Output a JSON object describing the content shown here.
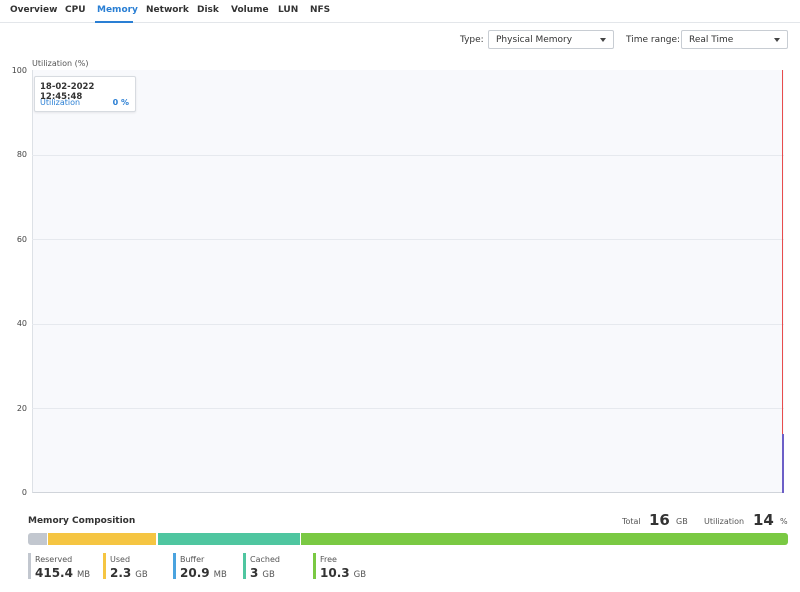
{
  "tabs": [
    {
      "label": "Overview",
      "active": false
    },
    {
      "label": "CPU",
      "active": false
    },
    {
      "label": "Memory",
      "active": true
    },
    {
      "label": "Network",
      "active": false
    },
    {
      "label": "Disk",
      "active": false
    },
    {
      "label": "Volume",
      "active": false
    },
    {
      "label": "LUN",
      "active": false
    },
    {
      "label": "NFS",
      "active": false
    }
  ],
  "filters": {
    "type_label": "Type:",
    "type_value": "Physical Memory",
    "time_label": "Time range:",
    "time_value": "Real Time"
  },
  "chart_data": {
    "type": "line",
    "title": "",
    "ylabel": "Utilization (%)",
    "ylim": [
      0,
      100
    ],
    "yticks": [
      "100",
      "80",
      "60",
      "40",
      "20",
      "0"
    ],
    "grid": true,
    "series": [
      {
        "name": "Utilization",
        "values": [
          0,
          14
        ]
      }
    ],
    "tooltip": {
      "date": "18-02-2022 12:45:48",
      "label": "Utilization",
      "value": "0 %"
    }
  },
  "composition": {
    "title": "Memory Composition",
    "total_label": "Total",
    "total_value": "16",
    "total_unit": "GB",
    "util_label": "Utilization",
    "util_value": "14",
    "util_unit": "%",
    "segments": [
      {
        "name": "Reserved",
        "value": "415.4",
        "unit": "MB",
        "color": "#c2c7cf",
        "fraction": 0.025
      },
      {
        "name": "Used",
        "value": "2.3",
        "unit": "GB",
        "color": "#f5c542",
        "fraction": 0.144
      },
      {
        "name": "Buffer",
        "value": "20.9",
        "unit": "MB",
        "color": "#4aa3df",
        "fraction": 0.001
      },
      {
        "name": "Cached",
        "value": "3",
        "unit": "GB",
        "color": "#4fc6a0",
        "fraction": 0.187
      },
      {
        "name": "Free",
        "value": "10.3",
        "unit": "GB",
        "color": "#7ac943",
        "fraction": 0.643
      }
    ]
  }
}
